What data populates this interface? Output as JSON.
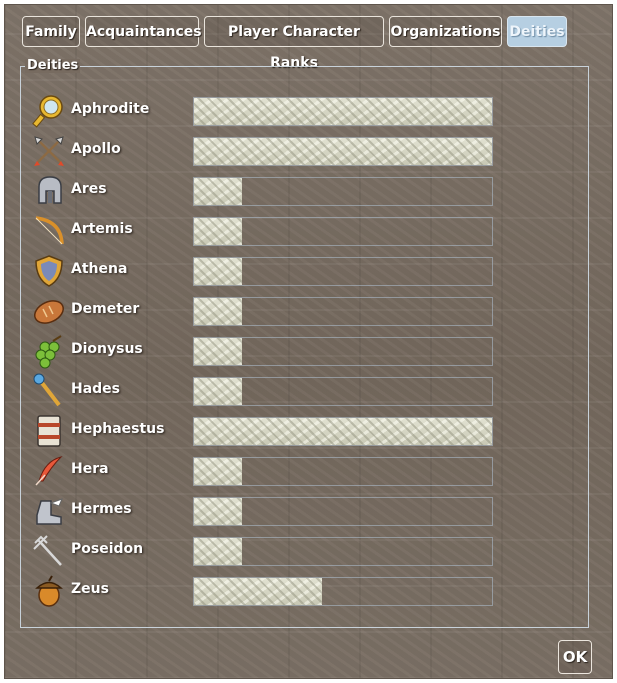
{
  "tabs": [
    {
      "label": "Family",
      "active": false
    },
    {
      "label": "Acquaintances",
      "active": false
    },
    {
      "label": "Player Character Ranks",
      "active": false
    },
    {
      "label": "Organizations",
      "active": false
    },
    {
      "label": "Deities",
      "active": true
    }
  ],
  "group_title": "Deities",
  "deities": [
    {
      "name": "Aphrodite",
      "icon": "mirror-icon",
      "level": 1.0
    },
    {
      "name": "Apollo",
      "icon": "crossed-arrows-icon",
      "level": 1.0
    },
    {
      "name": "Ares",
      "icon": "helmet-icon",
      "level": 0.16
    },
    {
      "name": "Artemis",
      "icon": "bow-icon",
      "level": 0.16
    },
    {
      "name": "Athena",
      "icon": "shield-icon",
      "level": 0.16
    },
    {
      "name": "Demeter",
      "icon": "bread-icon",
      "level": 0.16
    },
    {
      "name": "Dionysus",
      "icon": "grapes-icon",
      "level": 0.16
    },
    {
      "name": "Hades",
      "icon": "scepter-icon",
      "level": 0.16
    },
    {
      "name": "Hephaestus",
      "icon": "barrel-icon",
      "level": 1.0
    },
    {
      "name": "Hera",
      "icon": "feather-icon",
      "level": 0.16
    },
    {
      "name": "Hermes",
      "icon": "winged-boots-icon",
      "level": 0.16
    },
    {
      "name": "Poseidon",
      "icon": "trident-icon",
      "level": 0.16
    },
    {
      "name": "Zeus",
      "icon": "acorn-icon",
      "level": 0.43
    }
  ],
  "ok_label": "OK"
}
